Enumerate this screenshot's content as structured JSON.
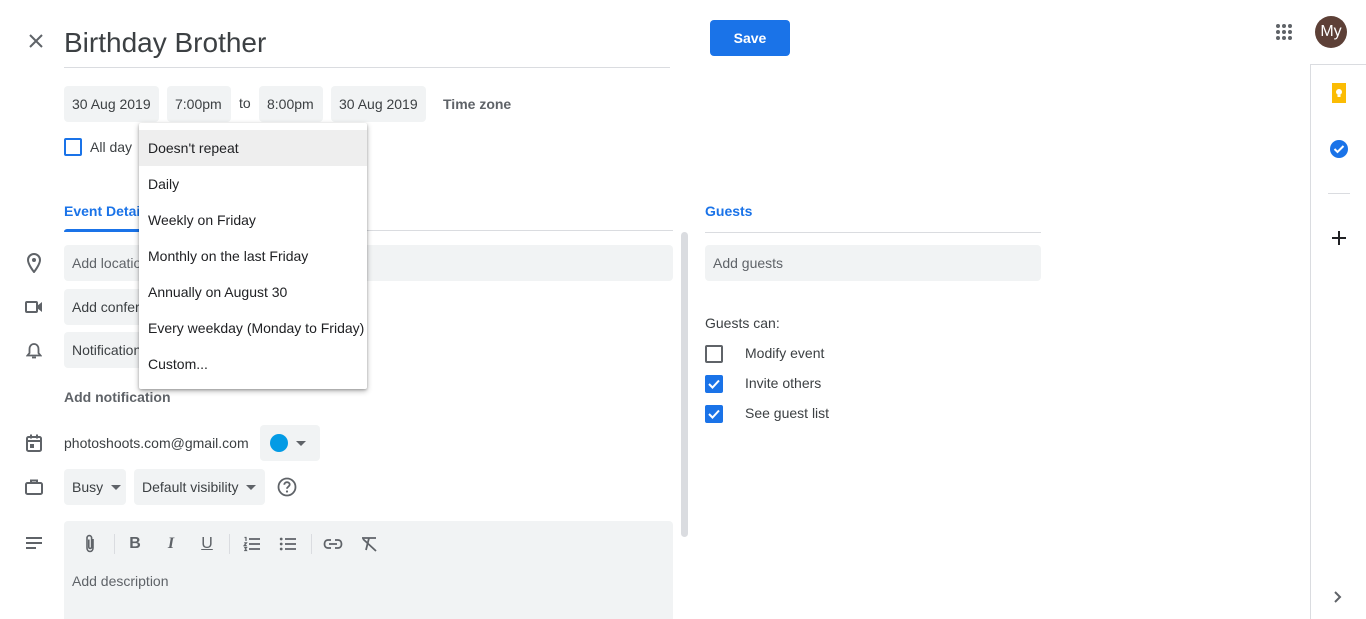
{
  "event": {
    "title": "Birthday Brother",
    "start_date": "30 Aug 2019",
    "start_time": "7:00pm",
    "to_label": "to",
    "end_time": "8:00pm",
    "end_date": "30 Aug 2019",
    "timezone_label": "Time zone",
    "all_day_label": "All day"
  },
  "header": {
    "save_label": "Save",
    "avatar_initials": "My"
  },
  "repeat_menu": {
    "items": [
      "Doesn't repeat",
      "Daily",
      "Weekly on Friday",
      "Monthly on the last Friday",
      "Annually on August 30",
      "Every weekday (Monday to Friday)",
      "Custom..."
    ],
    "selected_index": 0
  },
  "details": {
    "tab_label": "Event Details",
    "location_placeholder": "Add location",
    "conference_label": "Add conferencing",
    "notification_label": "Notification",
    "add_notification_label": "Add notification",
    "calendar_account": "photoshoots.com@gmail.com",
    "calendar_color": "#039be5",
    "busy_label": "Busy",
    "visibility_label": "Default visibility",
    "description_placeholder": "Add description"
  },
  "guests": {
    "tab_label": "Guests",
    "add_guests_placeholder": "Add guests",
    "guests_can_label": "Guests can:",
    "permissions": [
      {
        "label": "Modify event",
        "checked": false
      },
      {
        "label": "Invite others",
        "checked": true
      },
      {
        "label": "See guest list",
        "checked": true
      }
    ]
  },
  "colors": {
    "accent": "#1a73e8",
    "avatar_bg": "#5d4037"
  }
}
